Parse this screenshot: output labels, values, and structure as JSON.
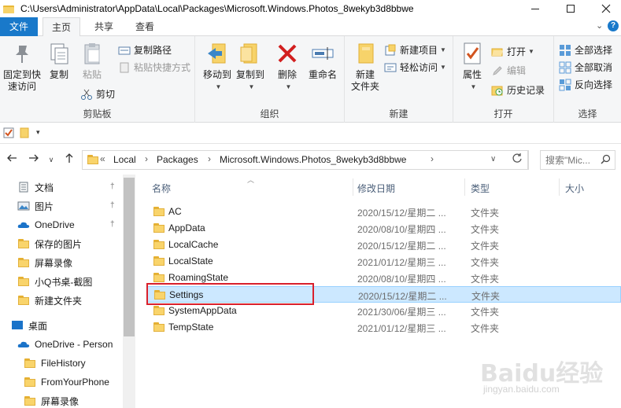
{
  "window": {
    "title": "C:\\Users\\Administrator\\AppData\\Local\\Packages\\Microsoft.Windows.Photos_8wekyb3d8bbwe"
  },
  "ribbon_tabs": [
    {
      "label": "文件"
    },
    {
      "label": "主页"
    },
    {
      "label": "共享"
    },
    {
      "label": "查看"
    }
  ],
  "ribbon": {
    "clipboard": {
      "label": "剪贴板",
      "pin_quick_access": "固定到快\n速访问",
      "pin_line1": "固定到快",
      "pin_line2": "速访问",
      "copy": "复制",
      "paste": "粘贴",
      "copy_path": "复制路径",
      "paste_shortcut": "粘贴快捷方式",
      "cut": "剪切"
    },
    "organize": {
      "label": "组织",
      "move_to": "移动到",
      "copy_to": "复制到",
      "delete": "删除",
      "rename": "重命名"
    },
    "new": {
      "label": "新建",
      "new_folder_line1": "新建",
      "new_folder_line2": "文件夹",
      "new_item": "新建项目",
      "easy_access": "轻松访问"
    },
    "open": {
      "label": "打开",
      "properties": "属性",
      "open": "打开",
      "edit": "编辑",
      "history": "历史记录"
    },
    "select": {
      "label": "选择",
      "select_all": "全部选择",
      "select_none": "全部取消",
      "invert": "反向选择"
    }
  },
  "address": {
    "overflow": "«",
    "crumbs": [
      "Local",
      "Packages",
      "Microsoft.Windows.Photos_8wekyb3d8bbwe"
    ]
  },
  "search": {
    "placeholder": "搜索\"Mic..."
  },
  "nav_pane": {
    "items": [
      {
        "label": "文档",
        "icon": "documents-icon",
        "pinned": true
      },
      {
        "label": "图片",
        "icon": "pictures-icon",
        "pinned": true
      },
      {
        "label": "OneDrive",
        "icon": "onedrive-icon",
        "pinned": true
      },
      {
        "label": "保存的图片",
        "icon": "folder-icon",
        "pinned": false
      },
      {
        "label": "屏幕录像",
        "icon": "folder-icon",
        "pinned": false
      },
      {
        "label": "小Q书桌-截图",
        "icon": "folder-icon",
        "pinned": false
      },
      {
        "label": "新建文件夹",
        "icon": "folder-icon",
        "pinned": false
      },
      {
        "label": "桌面",
        "icon": "desktop-icon",
        "pinned": false
      },
      {
        "label": "OneDrive - Person",
        "icon": "onedrive-icon",
        "pinned": false
      },
      {
        "label": "FileHistory",
        "icon": "folder-icon",
        "pinned": false
      },
      {
        "label": "FromYourPhone",
        "icon": "folder-icon",
        "pinned": false
      },
      {
        "label": "屏幕录像",
        "icon": "folder-icon",
        "pinned": false
      }
    ]
  },
  "file_list": {
    "columns": [
      "名称",
      "修改日期",
      "类型",
      "大小"
    ],
    "rows": [
      {
        "name": "AC",
        "date": "2020/15/12/星期二 ...",
        "type": "文件夹"
      },
      {
        "name": "AppData",
        "date": "2020/08/10/星期四 ...",
        "type": "文件夹"
      },
      {
        "name": "LocalCache",
        "date": "2020/15/12/星期二 ...",
        "type": "文件夹"
      },
      {
        "name": "LocalState",
        "date": "2021/01/12/星期三 ...",
        "type": "文件夹"
      },
      {
        "name": "RoamingState",
        "date": "2020/08/10/星期四 ...",
        "type": "文件夹"
      },
      {
        "name": "Settings",
        "date": "2020/15/12/星期二 ...",
        "type": "文件夹",
        "selected": true
      },
      {
        "name": "SystemAppData",
        "date": "2021/30/06/星期三 ...",
        "type": "文件夹"
      },
      {
        "name": "TempState",
        "date": "2021/01/12/星期三 ...",
        "type": "文件夹"
      }
    ]
  },
  "watermark": {
    "text": "Baidu经验",
    "sub": "jingyan.baidu.com"
  },
  "colors": {
    "accent": "#1979ca",
    "selection": "#cce8ff",
    "highlight_box": "#d9202c",
    "folder": "#f9d46b"
  }
}
